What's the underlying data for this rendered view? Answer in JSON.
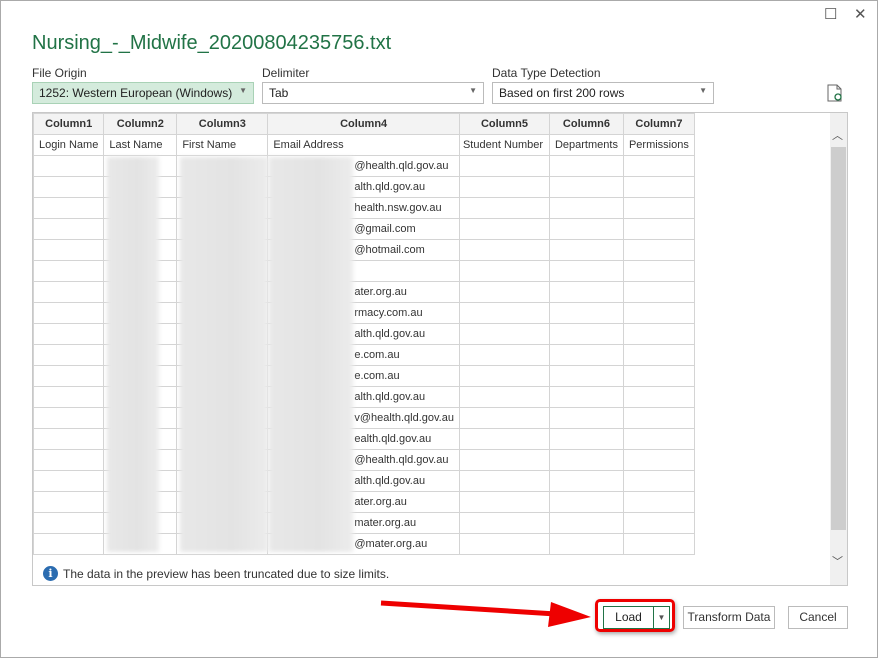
{
  "window": {
    "title": "Nursing_-_Midwife_20200804235756.txt",
    "maximize_icon": "square",
    "close_icon": "x"
  },
  "options": {
    "file_origin": {
      "label": "File Origin",
      "value": "1252: Western European (Windows)"
    },
    "delimiter": {
      "label": "Delimiter",
      "value": "Tab"
    },
    "detection": {
      "label": "Data Type Detection",
      "value": "Based on first 200 rows"
    }
  },
  "table": {
    "columns": [
      "Column1",
      "Column2",
      "Column3",
      "Column4",
      "Column5",
      "Column6",
      "Column7"
    ],
    "header_row": [
      "Login Name",
      "Last Name",
      "First Name",
      "Email Address",
      "Student Number",
      "Departments",
      "Permissions"
    ],
    "emails": [
      "@health.qld.gov.au",
      "alth.qld.gov.au",
      "health.nsw.gov.au",
      "@gmail.com",
      "@hotmail.com",
      "",
      "ater.org.au",
      "rmacy.com.au",
      "alth.qld.gov.au",
      "e.com.au",
      "e.com.au",
      "alth.qld.gov.au",
      "v@health.qld.gov.au",
      "ealth.qld.gov.au",
      "@health.qld.gov.au",
      "alth.qld.gov.au",
      "ater.org.au",
      "mater.org.au",
      "@mater.org.au"
    ]
  },
  "info_message": "The data in the preview has been truncated due to size limits.",
  "buttons": {
    "load": "Load",
    "transform": "Transform Data",
    "cancel": "Cancel"
  },
  "colors": {
    "accent": "#217346",
    "highlight": "#e00000"
  }
}
